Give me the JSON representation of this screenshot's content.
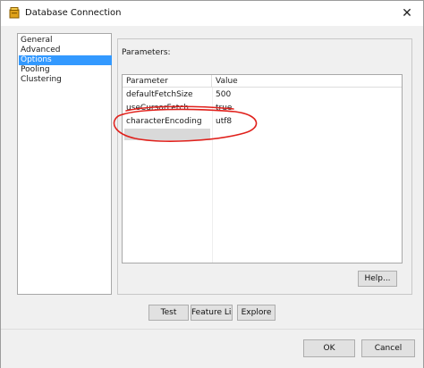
{
  "window": {
    "title": "Database Connection",
    "close_glyph": "✕",
    "icon": "database-connection-icon"
  },
  "sidebar": {
    "items": [
      {
        "label": "General",
        "selected": false
      },
      {
        "label": "Advanced",
        "selected": false
      },
      {
        "label": "Options",
        "selected": true
      },
      {
        "label": "Pooling",
        "selected": false
      },
      {
        "label": "Clustering",
        "selected": false
      }
    ]
  },
  "options": {
    "parameters_label": "Parameters:",
    "table": {
      "columns": [
        "Parameter",
        "Value"
      ],
      "rows": [
        {
          "parameter": "defaultFetchSize",
          "value": "500"
        },
        {
          "parameter": "useCursorFetch",
          "value": "true"
        },
        {
          "parameter": "characterEncoding",
          "value": "utf8"
        }
      ]
    },
    "help_label": "Help..."
  },
  "actions": {
    "test_label": "Test",
    "feature_list_label": "Feature List",
    "explore_label": "Explore"
  },
  "footer": {
    "ok_label": "OK",
    "cancel_label": "Cancel"
  },
  "colors": {
    "selection": "#3399ff",
    "annotation": "#e0201b",
    "edit_row": "#d9d9d9"
  }
}
